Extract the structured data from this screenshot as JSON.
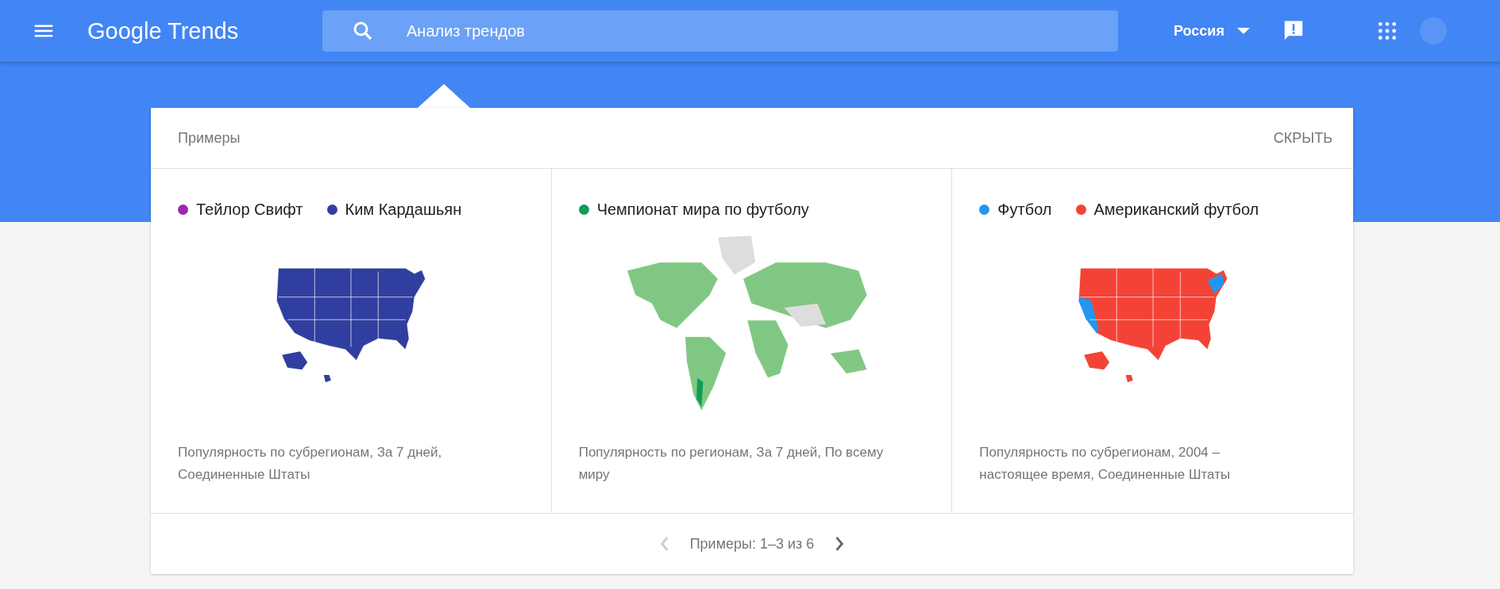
{
  "header": {
    "logo": "Google Trends",
    "search": {
      "placeholder": "Анализ трендов"
    },
    "region": "Россия"
  },
  "examples": {
    "title": "Примеры",
    "hide": "СКРЫТЬ",
    "cards": [
      {
        "kind": "usa",
        "terms": [
          {
            "label": "Тейлор Свифт",
            "color": "#9c27b0"
          },
          {
            "label": "Ким Кардашьян",
            "color": "#303f9f"
          }
        ],
        "caption": "Популярность по субрегионам, За 7 дней, Соединенные Штаты"
      },
      {
        "kind": "world",
        "terms": [
          {
            "label": "Чемпионат мира по футболу",
            "color": "#0f9d58"
          }
        ],
        "caption": "Популярность по регионам, За 7 дней, По всему миру"
      },
      {
        "kind": "usa",
        "terms": [
          {
            "label": "Футбол",
            "color": "#2196f3"
          },
          {
            "label": "Американский футбол",
            "color": "#f44336"
          }
        ],
        "caption": "Популярность по субрегионам, 2004 – настоящее время, Соединенные Штаты"
      }
    ],
    "pager": {
      "label": "Примеры: 1–3 из 6",
      "prev_disabled": true,
      "next_disabled": false
    }
  }
}
